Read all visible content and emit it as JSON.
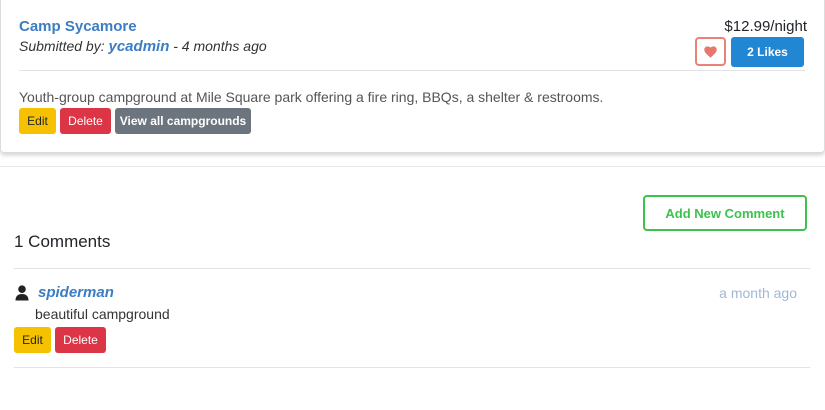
{
  "campground": {
    "title": "Camp Sycamore",
    "submitted_prefix": "Submitted by: ",
    "author": "ycadmin",
    "time_suffix": " - 4 months ago",
    "price": "$12.99/night",
    "likes_label": "2 Likes",
    "description": "Youth-group campground at Mile Square park offering a fire ring, BBQs, a shelter & restrooms.",
    "edit_label": "Edit",
    "delete_label": "Delete",
    "view_all_label": "View all campgrounds"
  },
  "comments": {
    "add_label": "Add New Comment",
    "count_label": "1 Comments",
    "items": [
      {
        "author": "spiderman",
        "time": "a month ago",
        "text": "beautiful campground",
        "edit_label": "Edit",
        "delete_label": "Delete"
      }
    ]
  },
  "colors": {
    "link_blue": "#3b7dc4",
    "like_blue": "#2186d4",
    "heart_red": "#e8766a",
    "edit_yellow": "#f6c100",
    "delete_red": "#dc3545",
    "gray_button": "#6c757d",
    "add_comment_green": "#3cc24d"
  },
  "icons": {
    "heart": "heart-icon",
    "user": "user-icon"
  }
}
